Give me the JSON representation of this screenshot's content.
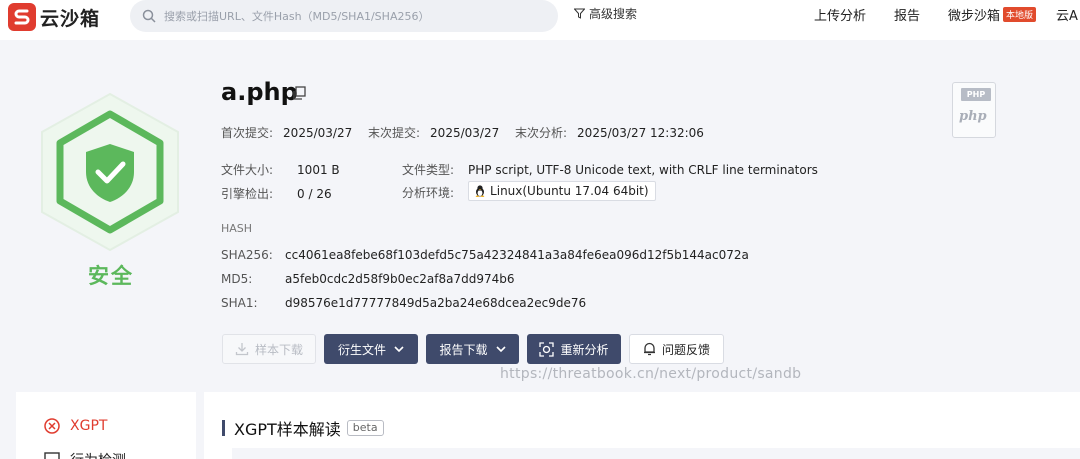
{
  "brand": {
    "name": "云沙箱"
  },
  "search": {
    "placeholder": "搜索或扫描URL、文件Hash（MD5/SHA1/SHA256）"
  },
  "header": {
    "advanced_search": "高级搜索",
    "nav": [
      "上传分析",
      "报告",
      "微步沙箱",
      "云A"
    ],
    "local_badge": "本地版"
  },
  "file": {
    "name": "a.php",
    "verdict": "安全",
    "first_submit_label": "首次提交:",
    "first_submit": "2025/03/27",
    "last_submit_label": "末次提交:",
    "last_submit": "2025/03/27",
    "last_analysis_label": "末次分析:",
    "last_analysis": "2025/03/27 12:32:06",
    "size_label": "文件大小:",
    "size": "1001 B",
    "type_label": "文件类型:",
    "type": "PHP script, UTF-8 Unicode text, with CRLF line terminators",
    "engines_label": "引擎检出:",
    "engines": "0 / 26",
    "env_label": "分析环境:",
    "env": "Linux(Ubuntu 17.04 64bit)",
    "thumb_tag": "PHP",
    "thumb_word": "php"
  },
  "hash": {
    "heading": "HASH",
    "sha256_label": "SHA256:",
    "sha256": "cc4061ea8febe68f103defd5c75a42324841a3a84fe6ea096d12f5b144ac072a",
    "md5_label": "MD5:",
    "md5": "a5feb0cdc2d58f9b0ec2af8a7dd974b6",
    "sha1_label": "SHA1:",
    "sha1": "d98576e1d77777849d5a2ba24e68dcea2ec9de76"
  },
  "actions": {
    "sample_download": "样本下载",
    "derived_files": "衍生文件",
    "report_download": "报告下载",
    "reanalyze": "重新分析",
    "feedback": "问题反馈"
  },
  "watermark": "https://threatbook.cn/next/product/sandb",
  "sidebar": {
    "items": [
      "XGPT",
      "行为检测"
    ]
  },
  "section": {
    "title": "XGPT样本解读",
    "beta": "beta"
  },
  "colors": {
    "safe": "#5cb85c",
    "primary_button": "#3f4a6b",
    "brand": "#e03c2f"
  }
}
